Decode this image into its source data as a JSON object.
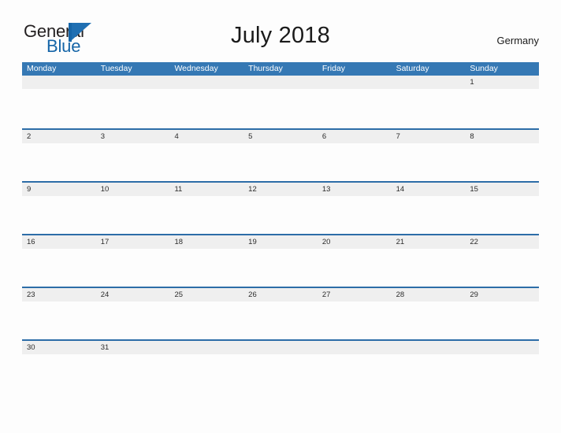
{
  "logo": {
    "word_one": "General",
    "word_two": "Blue",
    "mark_icon": "triangle-flag-icon",
    "colors": {
      "word_one": "#231f20",
      "word_two": "#1565a8",
      "mark": "#1f6fb2"
    }
  },
  "header": {
    "title": "July 2018",
    "country": "Germany"
  },
  "colors": {
    "header_blue": "#3578b4",
    "row_separator_blue": "#2d6da8",
    "day_band_gray": "#efefef",
    "page_background": "#fdfdfd",
    "weekday_text": "#ffffff",
    "day_number_text": "#2b2b2b"
  },
  "calendar": {
    "month": "July",
    "year": "2018",
    "weekday_headers": [
      "Monday",
      "Tuesday",
      "Wednesday",
      "Thursday",
      "Friday",
      "Saturday",
      "Sunday"
    ],
    "weeks": [
      {
        "bordered": false,
        "days": [
          "",
          "",
          "",
          "",
          "",
          "",
          "1"
        ]
      },
      {
        "bordered": true,
        "days": [
          "2",
          "3",
          "4",
          "5",
          "6",
          "7",
          "8"
        ]
      },
      {
        "bordered": true,
        "days": [
          "9",
          "10",
          "11",
          "12",
          "13",
          "14",
          "15"
        ]
      },
      {
        "bordered": true,
        "days": [
          "16",
          "17",
          "18",
          "19",
          "20",
          "21",
          "22"
        ]
      },
      {
        "bordered": true,
        "days": [
          "23",
          "24",
          "25",
          "26",
          "27",
          "28",
          "29"
        ]
      },
      {
        "bordered": true,
        "days": [
          "30",
          "31",
          "",
          "",
          "",
          "",
          ""
        ]
      }
    ]
  }
}
